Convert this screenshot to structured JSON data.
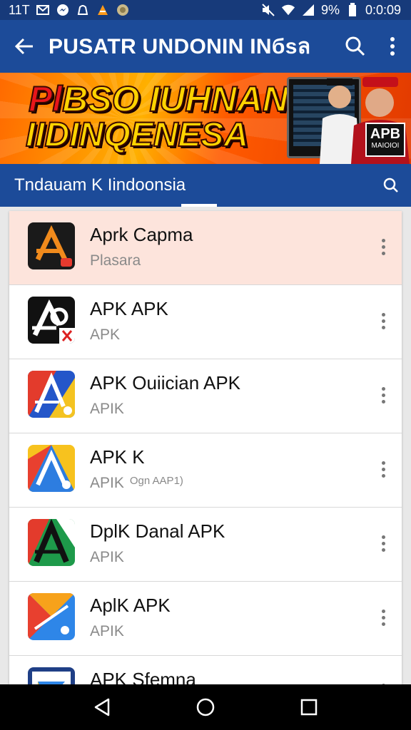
{
  "status_bar": {
    "left_text": "11T",
    "battery_text": "9%",
    "time": "0:0:09",
    "icons": [
      "gmail-icon",
      "messenger-icon",
      "whatsapp-icon",
      "vlc-icon",
      "coin-icon",
      "mute-icon",
      "wifi-icon",
      "signal-icon",
      "battery-icon"
    ]
  },
  "app_bar": {
    "title": "PUSATR UNDONIN INбsล",
    "icons": [
      "back-arrow-icon",
      "search-icon",
      "more-vert-icon"
    ]
  },
  "banner": {
    "line1_red": "Pl",
    "line1_rest": "BSO IUHNAN",
    "line2": "IIDINQENESA",
    "badge": "APB",
    "badge_small": "ΜΑΙΟΙΟΙ"
  },
  "tab_bar": {
    "label": "Tndauam K  Iindoonsia",
    "icon": "search-icon"
  },
  "apps": [
    {
      "title": "Aprk Capma",
      "subtitle": "Plasara",
      "extra": "",
      "highlighted": true
    },
    {
      "title": "APK APK",
      "subtitle": "APK",
      "extra": "",
      "highlighted": false
    },
    {
      "title": "APK Ouiician APK",
      "subtitle": "APIK",
      "extra": "",
      "highlighted": false
    },
    {
      "title": "APK K",
      "subtitle": "APIK",
      "extra": "Ogn AAP1)",
      "highlighted": false
    },
    {
      "title": "DplK Danal APK",
      "subtitle": "APIK",
      "extra": "",
      "highlighted": false
    },
    {
      "title": "AplK APK",
      "subtitle": "APIK",
      "extra": "",
      "highlighted": false
    },
    {
      "title": "APK Sfemna",
      "subtitle": "",
      "extra": "",
      "highlighted": false
    }
  ],
  "nav_bar": {
    "icons": [
      "nav-back-icon",
      "nav-home-icon",
      "nav-recents-icon"
    ]
  },
  "colors": {
    "status_bar": "#173a7a",
    "app_bar": "#1c4b99",
    "highlight_row": "#fde4dc",
    "banner_orange": "#ff6a00"
  }
}
